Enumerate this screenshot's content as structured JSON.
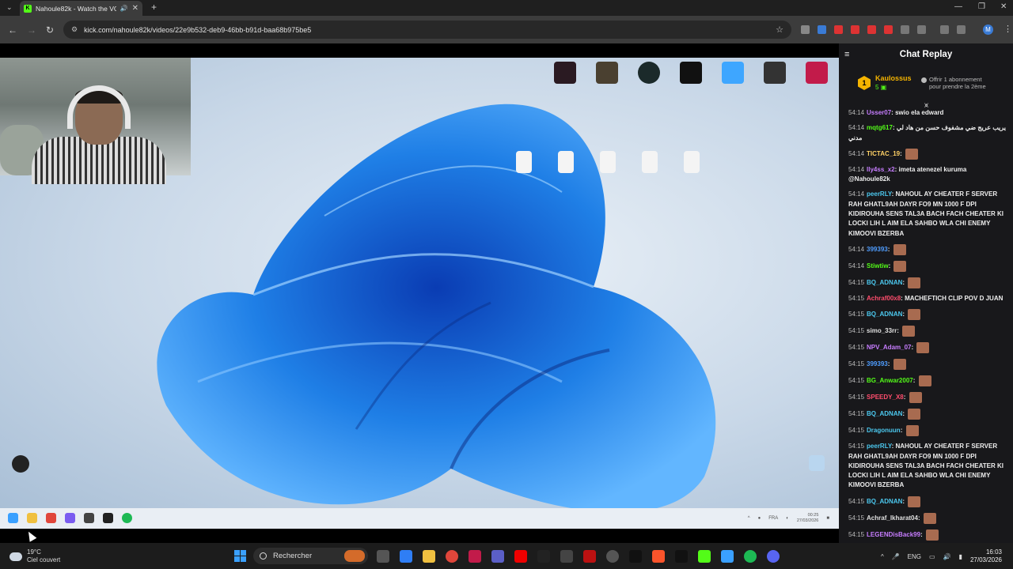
{
  "browser": {
    "tab_title": "Nahoule82k - Watch the VO",
    "tab_favicon": "K",
    "url": "kick.com/nahoule82k/videos/22e9b532-deb9-46bb-b91d-baa68b975be5"
  },
  "chat": {
    "title": "Chat Replay",
    "pinned": {
      "badge": "1",
      "user": "Kaulossus",
      "count": "5",
      "gift_line1": "Offrir 1 abonnement",
      "gift_line2": "pour prendre la 2ème"
    },
    "messages": [
      {
        "ts": "54:14",
        "user": "Usser07",
        "color": "#c77dff",
        "text": "swio ela edward"
      },
      {
        "ts": "54:14",
        "user": "mqtg617",
        "color": "#53fc18",
        "text": "يريب عريج ضي مشفوف حسن من هاد لي مدني"
      },
      {
        "ts": "54:14",
        "user": "TICTAC_19",
        "color": "#ffd166",
        "text": "",
        "emote": true
      },
      {
        "ts": "54:14",
        "user": "lly4ss_x2",
        "color": "#c77dff",
        "text": "imeta atenezel kuruma @Nahoule82k"
      },
      {
        "ts": "54:14",
        "user": "peerRLY",
        "color": "#4cc9f0",
        "text": "NAHOUL AY CHEATER F SERVER RAH GHATL9AH DAYR FO9 MN 1000 F DPI KIDIROUHA SENS TAL3A BACH FACH CHEATER KI LOCKI LIH L AIM ELA SAHBO WLA CHI ENEMY KIMOOVI BZERBA"
      },
      {
        "ts": "54:14",
        "user": "399393",
        "color": "#4f9dff",
        "text": "",
        "emote": true
      },
      {
        "ts": "54:14",
        "user": "Stiwtiw",
        "color": "#53fc18",
        "text": "",
        "emote": true
      },
      {
        "ts": "54:15",
        "user": "BQ_ADNAN",
        "color": "#4cc9f0",
        "text": "",
        "emote": true
      },
      {
        "ts": "54:15",
        "user": "Achraf00x8",
        "color": "#ff4d6d",
        "text": "MACHEFTICH CLIP POV D JUAN"
      },
      {
        "ts": "54:15",
        "user": "BQ_ADNAN",
        "color": "#4cc9f0",
        "text": "",
        "emote": true
      },
      {
        "ts": "54:15",
        "user": "simo_33rr",
        "color": "#e0e0e0",
        "text": "",
        "emote": true
      },
      {
        "ts": "54:15",
        "user": "NPV_Adam_07",
        "color": "#c77dff",
        "text": "",
        "emote": true
      },
      {
        "ts": "54:15",
        "user": "399393",
        "color": "#4f9dff",
        "text": "",
        "emote": true
      },
      {
        "ts": "54:15",
        "user": "BG_Anwar2007",
        "color": "#53fc18",
        "text": "",
        "emote": true
      },
      {
        "ts": "54:15",
        "user": "SPEEDY_X8",
        "color": "#ff4d6d",
        "text": "",
        "emote": true
      },
      {
        "ts": "54:15",
        "user": "BQ_ADNAN",
        "color": "#4cc9f0",
        "text": "",
        "emote": true
      },
      {
        "ts": "54:15",
        "user": "Dragonuun",
        "color": "#4cc9f0",
        "text": "",
        "emote": true
      },
      {
        "ts": "54:15",
        "user": "peerRLY",
        "color": "#4cc9f0",
        "text": "NAHOUL AY CHEATER F SERVER RAH GHATL9AH DAYR FO9 MN 1000 F DPI KIDIROUHA SENS TAL3A BACH FACH CHEATER KI LOCKI LIH L AIM ELA SAHBO WLA CHI ENEMY KIMOOVI BZERBA"
      },
      {
        "ts": "54:15",
        "user": "BQ_ADNAN",
        "color": "#4cc9f0",
        "text": "",
        "emote": true
      },
      {
        "ts": "54:15",
        "user": "Achraf_lkharat04",
        "color": "#e0e0e0",
        "text": "",
        "emote": true
      },
      {
        "ts": "54:15",
        "user": "LEGENDisBack99",
        "color": "#c77dff",
        "text": "",
        "emote": true
      },
      {
        "ts": "54:15",
        "user": "Dragonuun",
        "color": "#4cc9f0",
        "text": "",
        "emote": true
      }
    ]
  },
  "taskbar": {
    "weather_temp": "19°C",
    "weather_desc": "Ciel couvert",
    "search_label": "Rechercher",
    "lang": "ENG",
    "time": "16:03",
    "date": "27/03/2026"
  },
  "video_sysbar": {
    "lang": "FRA",
    "time": "00:25",
    "date": "27/03/2026"
  }
}
